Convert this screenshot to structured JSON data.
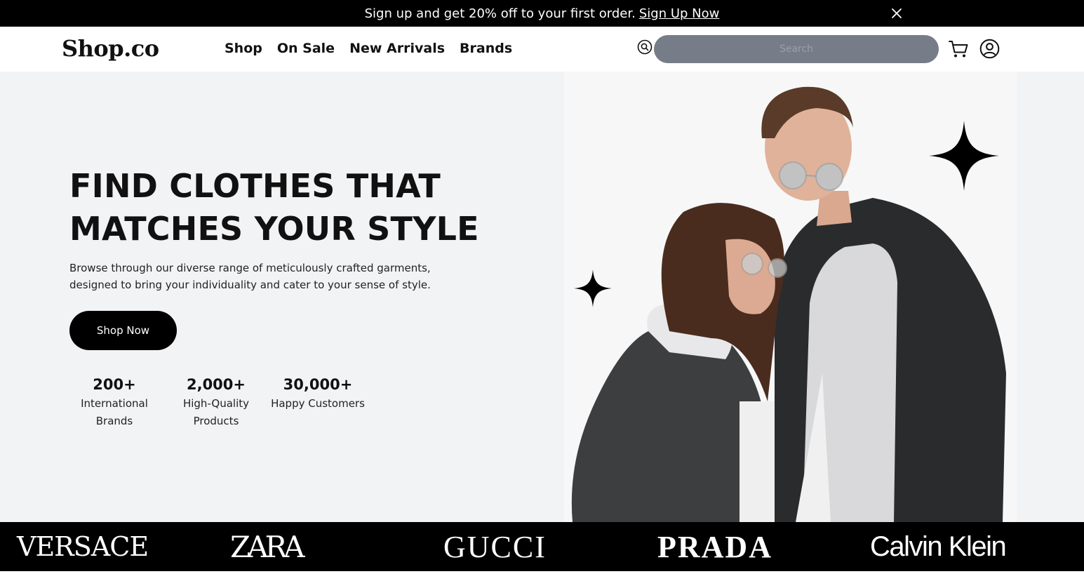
{
  "promo": {
    "text": "Sign up and get 20% off to your first order.",
    "link": "Sign Up Now",
    "close_icon": "close-icon"
  },
  "header": {
    "logo": "Shop.co",
    "nav": [
      "Shop",
      "On Sale",
      "New Arrivals",
      "Brands"
    ],
    "search": {
      "placeholder": "Search",
      "icon": "search-icon"
    },
    "cart_icon": "cart-icon",
    "account_icon": "user-icon"
  },
  "hero": {
    "headline_line1": "FIND CLOTHES THAT",
    "headline_line2": "MATCHES YOUR STYLE",
    "subtext": "Browse through our diverse range of meticulously crafted garments, designed to bring your individuality and cater to your sense of style.",
    "cta": "Shop Now",
    "stats": [
      {
        "value": "200+",
        "label_line1": "International",
        "label_line2": "Brands"
      },
      {
        "value": "2,000+",
        "label_line1": "High-Quality",
        "label_line2": "Products"
      },
      {
        "value": "30,000+",
        "label_line1": "Happy Customers",
        "label_line2": ""
      }
    ]
  },
  "brands": [
    "VERSACE",
    "ZARA",
    "GUCCI",
    "PRADA",
    "Calvin Klein"
  ],
  "colors": {
    "promo_bg": "#000000",
    "hero_bg": "#f2f3f5",
    "search_bg": "#767c88",
    "cta_bg": "#000000",
    "brands_bg": "#000000"
  }
}
